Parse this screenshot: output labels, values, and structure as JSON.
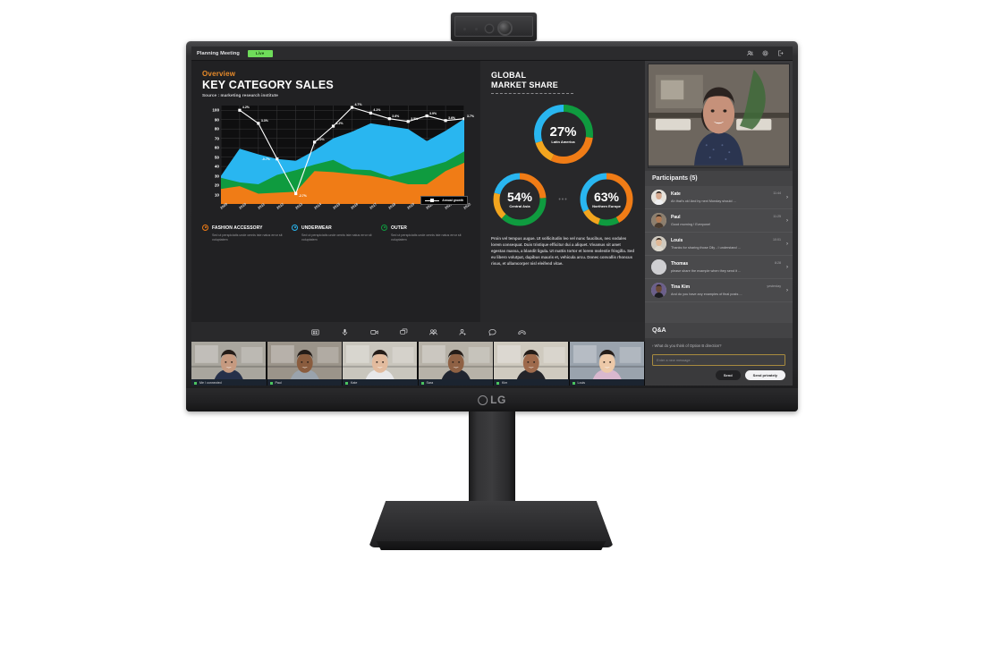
{
  "device": {
    "brand": "LG",
    "logo_icon": "lg-logo",
    "webcam_icon": "webcam"
  },
  "app": {
    "title": "Planning Meeting",
    "live_badge": "Live",
    "titlebar_icons": [
      "add-people-icon",
      "settings-gear-icon",
      "exit-icon"
    ]
  },
  "slide": {
    "eyebrow": "Overview",
    "title": "KEY CATEGORY SALES",
    "source": "Source : marketing research institute",
    "legend": [
      {
        "name": "FASHION ACCESSORY",
        "color": "#f07c16",
        "desc": "Sed ut perspiciatis unde omnis iste natus error sit voluptatem"
      },
      {
        "name": "UNDERWEAR",
        "color": "#29b6f0",
        "desc": "Sed ut perspiciatis unde omnis iste natus error sit voluptatem"
      },
      {
        "name": "OUTER",
        "color": "#0f9b3f",
        "desc": "Sed ut perspiciatis unde omnis iste natus error sit voluptatem"
      }
    ],
    "right": {
      "title_line1": "GLOBAL",
      "title_line2": "MARKET SHARE",
      "separator_dots": "•••",
      "body": "Proin vel tempus augue. Ut sollicitudin leo vel nunc faucibus, nec sodales lorem consequat. Duis tristique efficitur dui a aliquet. Vivamus sit amet egestas massa, a blandit ligula. Ut mattis tortor et lorem molestie fringilla. Sed eu libero volutpat, dapibus mauris et, vehicula arcu. Donec convallis rhoncus risus, et ullamcorper nisl eleifend vitae."
    }
  },
  "chart_data": {
    "type": "area",
    "title": "KEY CATEGORY SALES",
    "xlabel": "",
    "ylabel": "",
    "ylim": [
      0,
      100
    ],
    "yticks": [
      10,
      20,
      30,
      40,
      50,
      60,
      70,
      80,
      90,
      100
    ],
    "grid": true,
    "legend_position": "below",
    "categories": [
      "2009",
      "2010",
      "2011",
      "2012",
      "2013",
      "2014",
      "2015",
      "2016",
      "2017",
      "2018",
      "2019",
      "2020",
      "2021",
      "2022"
    ],
    "series": [
      {
        "name": "FASHION ACCESSORY",
        "color": "#f07c16",
        "stacked": true,
        "values": [
          16,
          19,
          11,
          12,
          13,
          35,
          34,
          32,
          30,
          26,
          21,
          21,
          35,
          44
        ]
      },
      {
        "name": "OUTER",
        "color": "#0f9b3f",
        "stacked": true,
        "values": [
          28,
          23,
          21,
          31,
          36,
          42,
          47,
          37,
          36,
          29,
          34,
          39,
          45,
          56
        ]
      },
      {
        "name": "UNDERWEAR",
        "color": "#29b6f0",
        "stacked": true,
        "values": [
          30,
          59,
          53,
          48,
          46,
          57,
          70,
          77,
          86,
          83,
          80,
          67,
          78,
          91
        ]
      }
    ],
    "overlay": {
      "name": "Annual growth",
      "color": "#ffffff",
      "values": [
        null,
        100,
        86,
        48,
        11,
        66,
        83,
        103,
        97,
        91,
        88,
        94,
        89,
        91
      ],
      "point_labels": [
        "",
        "4.2%",
        "3.3%",
        "-0.7%",
        "-2.7%",
        "2.0%",
        "3.2%",
        "4.7%",
        "4.1%",
        "3.6%",
        "3.5%",
        "3.9%",
        "3.6%",
        "3.7%"
      ]
    }
  },
  "donuts": [
    {
      "pct": "27%",
      "region": "Latin America",
      "size": 72,
      "segments": [
        {
          "color": "#0f9b3f",
          "pct": 27
        },
        {
          "color": "#f07c16",
          "pct": 30
        },
        {
          "color": "#f2a51e",
          "pct": 13
        },
        {
          "color": "#29b6f0",
          "pct": 30
        }
      ]
    },
    {
      "pct": "54%",
      "region": "Central Asia",
      "size": 64,
      "segments": [
        {
          "color": "#f07c16",
          "pct": 24
        },
        {
          "color": "#0f9b3f",
          "pct": 38
        },
        {
          "color": "#f2a51e",
          "pct": 17
        },
        {
          "color": "#29b6f0",
          "pct": 21
        }
      ]
    },
    {
      "pct": "63%",
      "region": "Northern Europe",
      "size": 64,
      "segments": [
        {
          "color": "#f07c16",
          "pct": 42
        },
        {
          "color": "#0f9b3f",
          "pct": 13
        },
        {
          "color": "#f2a51e",
          "pct": 12
        },
        {
          "color": "#29b6f0",
          "pct": 33
        }
      ]
    }
  ],
  "toolbar": {
    "items": [
      {
        "icon": "layout-grid-icon",
        "label": "Layout"
      },
      {
        "icon": "microphone-icon",
        "label": "Microphone"
      },
      {
        "icon": "video-camera-icon",
        "label": "Camera"
      },
      {
        "icon": "screen-share-icon",
        "label": "Share screen"
      },
      {
        "icon": "participants-icon",
        "label": "Participants"
      },
      {
        "icon": "add-person-icon",
        "label": "Invite"
      },
      {
        "icon": "chat-bubble-icon",
        "label": "Chat"
      },
      {
        "icon": "end-call-icon",
        "label": "Leave"
      }
    ]
  },
  "filmstrip": {
    "tiles": [
      {
        "label": "Me / connected",
        "status": "online"
      },
      {
        "label": "Paul",
        "status": "online"
      },
      {
        "label": "Kate",
        "status": "online"
      },
      {
        "label": "Sara",
        "status": "online"
      },
      {
        "label": "Kim",
        "status": "online"
      },
      {
        "label": "Louis",
        "status": "online"
      }
    ]
  },
  "sidebar": {
    "self_view_label": "self-view",
    "participants_title": "Participants (5)",
    "participants": [
      {
        "name": "Kate",
        "message": "Ah that's ok! And by next Monday should ...",
        "time": "11:44"
      },
      {
        "name": "Paul",
        "message": "Good morning ! Everyone!",
        "time": "11:25"
      },
      {
        "name": "Louis",
        "message": "Thanks for sharing those Dlly - I understand ...",
        "time": "10:01"
      },
      {
        "name": "Thomas",
        "message": "please share the example when they send it ...",
        "time": "8:28"
      },
      {
        "name": "Tina Kim",
        "message": "And do you have any examples of final posts ...",
        "time": "yesterday"
      }
    ],
    "qa": {
      "title": "Q&A",
      "question": "What do you think of Option B direction?",
      "input_placeholder": "Enter a new message ...",
      "send_label": "Send",
      "send_privately_label": "Send privately"
    }
  }
}
